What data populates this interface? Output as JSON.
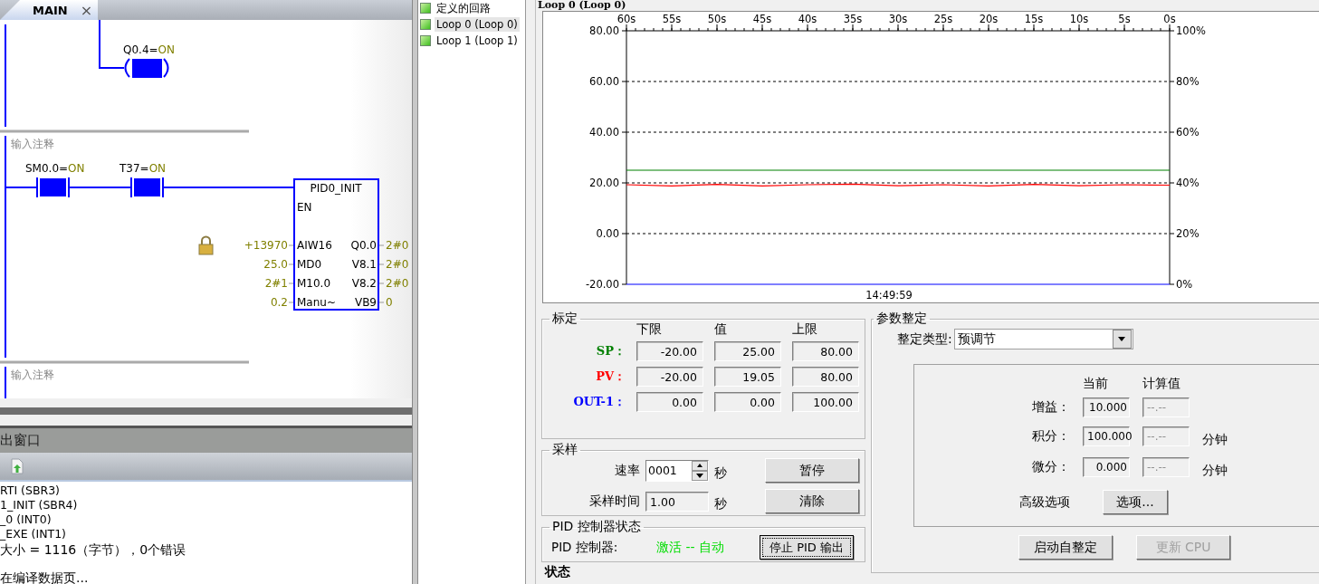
{
  "editor_tab": {
    "label": "MAIN",
    "close": "×",
    "selected": true
  },
  "networks": [
    {
      "coil": {
        "label": "Q0.4=",
        "state": "ON",
        "energized": true
      }
    },
    {
      "comment": "输入注释",
      "contacts": [
        {
          "label": "SM0.0=",
          "state": "ON",
          "energized": true
        },
        {
          "label": "T37=",
          "state": "ON",
          "energized": true
        }
      ],
      "locked": true,
      "block": {
        "name": "PID0_INIT",
        "enable": "EN",
        "inputs": [
          {
            "pin": "AIW16",
            "value": "+13970"
          },
          {
            "pin": "MD0",
            "value": "25.0"
          },
          {
            "pin": "M10.0",
            "value": "2#1"
          },
          {
            "pin": "Manu~",
            "value": "0.2"
          }
        ],
        "outputs": [
          {
            "pin": "Q0.0",
            "value": "2#0"
          },
          {
            "pin": "V8.1",
            "value": "2#0"
          },
          {
            "pin": "V8.2",
            "value": "2#0"
          },
          {
            "pin": "VB9",
            "value": "0"
          }
        ]
      }
    },
    {
      "comment": "输入注释"
    }
  ],
  "output_window": {
    "title": "出窗口",
    "lines": [
      {
        "kind": "entry",
        "text": "RTI (SBR3)"
      },
      {
        "kind": "entry",
        "text": "1_INIT (SBR4)"
      },
      {
        "kind": "entry",
        "text": "_0 (INT0)"
      },
      {
        "kind": "entry",
        "text": "_EXE (INT1)"
      },
      {
        "kind": "message",
        "text": "大小 = 1116（字节），0个错误"
      },
      {
        "kind": "message",
        "text": "在编译数据页..."
      }
    ]
  },
  "loop_tree": {
    "items": [
      {
        "label": "定义的回路",
        "children": [
          {
            "label": "Loop 0 (Loop 0)",
            "selected": true
          },
          {
            "label": "Loop 1 (Loop 1)",
            "selected": false
          }
        ]
      }
    ]
  },
  "trend": {
    "chart_data": {
      "type": "line",
      "title": "Loop 0 (Loop 0)",
      "xlabel": "14:49:59",
      "x": [
        60,
        55,
        50,
        45,
        40,
        35,
        30,
        25,
        20,
        15,
        10,
        5,
        0
      ],
      "xlim": [
        60,
        0
      ],
      "xticks": [
        {
          "value": 60,
          "label": "60s"
        },
        {
          "value": 55,
          "label": "55s"
        },
        {
          "value": 50,
          "label": "50s"
        },
        {
          "value": 45,
          "label": "45s"
        },
        {
          "value": 40,
          "label": "40s"
        },
        {
          "value": 35,
          "label": "35s"
        },
        {
          "value": 30,
          "label": "30s"
        },
        {
          "value": 25,
          "label": "25s"
        },
        {
          "value": 20,
          "label": "20s"
        },
        {
          "value": 15,
          "label": "15s"
        },
        {
          "value": 10,
          "label": "10s"
        },
        {
          "value": 5,
          "label": "5s"
        },
        {
          "value": 0,
          "label": "0s"
        }
      ],
      "ylim": [
        -20,
        80
      ],
      "yticks": [
        {
          "value": 80,
          "label": "80.00"
        },
        {
          "value": 60,
          "label": "60.00"
        },
        {
          "value": 40,
          "label": "40.00"
        },
        {
          "value": 20,
          "label": "20.00"
        },
        {
          "value": 0,
          "label": "0.00"
        },
        {
          "value": -20,
          "label": "-20.00"
        }
      ],
      "grid": true,
      "y2lim": [
        0,
        100
      ],
      "y2ticks": [
        {
          "value": 100,
          "label": "100%"
        },
        {
          "value": 80,
          "label": "80%"
        },
        {
          "value": 60,
          "label": "60%"
        },
        {
          "value": 40,
          "label": "40%"
        },
        {
          "value": 20,
          "label": "20%"
        },
        {
          "value": 0,
          "label": "0%"
        }
      ],
      "series": [
        {
          "color": "#008000",
          "values": [
            25,
            25,
            25,
            25,
            25,
            25,
            25,
            25,
            25,
            25,
            25,
            25,
            25
          ]
        },
        {
          "color": "#ff0000",
          "values": [
            19.3,
            18.8,
            19.4,
            18.8,
            19.3,
            19.5,
            18.9,
            19.3,
            18.8,
            19.4,
            18.9,
            19.3,
            19.1
          ]
        },
        {
          "color": "#0000ff",
          "values": [
            -20,
            -20,
            -20,
            -20,
            -20,
            -20,
            -20,
            -20,
            -20,
            -20,
            -20,
            -20,
            -20
          ]
        }
      ]
    }
  },
  "scaling": {
    "title": "标定",
    "columns": [
      "下限",
      "值",
      "上限"
    ],
    "rows": [
      {
        "label": "SP：",
        "color": "#008000",
        "values": [
          "-20.00",
          "25.00",
          "80.00"
        ]
      },
      {
        "label": "PV：",
        "color": "#ff0000",
        "values": [
          "-20.00",
          "19.05",
          "80.00"
        ]
      },
      {
        "label": "OUT-1：",
        "color": "#0000ff",
        "values": [
          "0.00",
          "0.00",
          "100.00"
        ]
      }
    ]
  },
  "sampling": {
    "title": "采样",
    "rate_label": "速率",
    "rate": "0001",
    "rate_unit": "秒",
    "time_label": "采样时间",
    "time": "1.00",
    "time_unit": "秒",
    "buttons": [
      "暂停",
      "清除"
    ]
  },
  "pid_status": {
    "title": "PID 控制器状态",
    "label": "PID 控制器:",
    "status": "激活 -- 自动",
    "button": "停止 PID 输出"
  },
  "tuning": {
    "title": "参数整定",
    "type_label": "整定类型:",
    "type": "预调节",
    "columns": [
      "当前",
      "计算值"
    ],
    "rows": [
      {
        "label": "增益：",
        "current": "10.000",
        "calculated": "--.--"
      },
      {
        "label": "积分：",
        "current": "100.000",
        "calculated": "--.--",
        "unit": "分钟"
      },
      {
        "label": "微分：",
        "current": "0.000",
        "calculated": "--.--",
        "unit": "分钟"
      }
    ],
    "advanced_label": "高级选项",
    "options_button": "选项...",
    "buttons": [
      {
        "label": "启动自整定",
        "disabled": false
      },
      {
        "label": "更新 CPU",
        "disabled": true
      }
    ]
  },
  "status_heading": "状态"
}
